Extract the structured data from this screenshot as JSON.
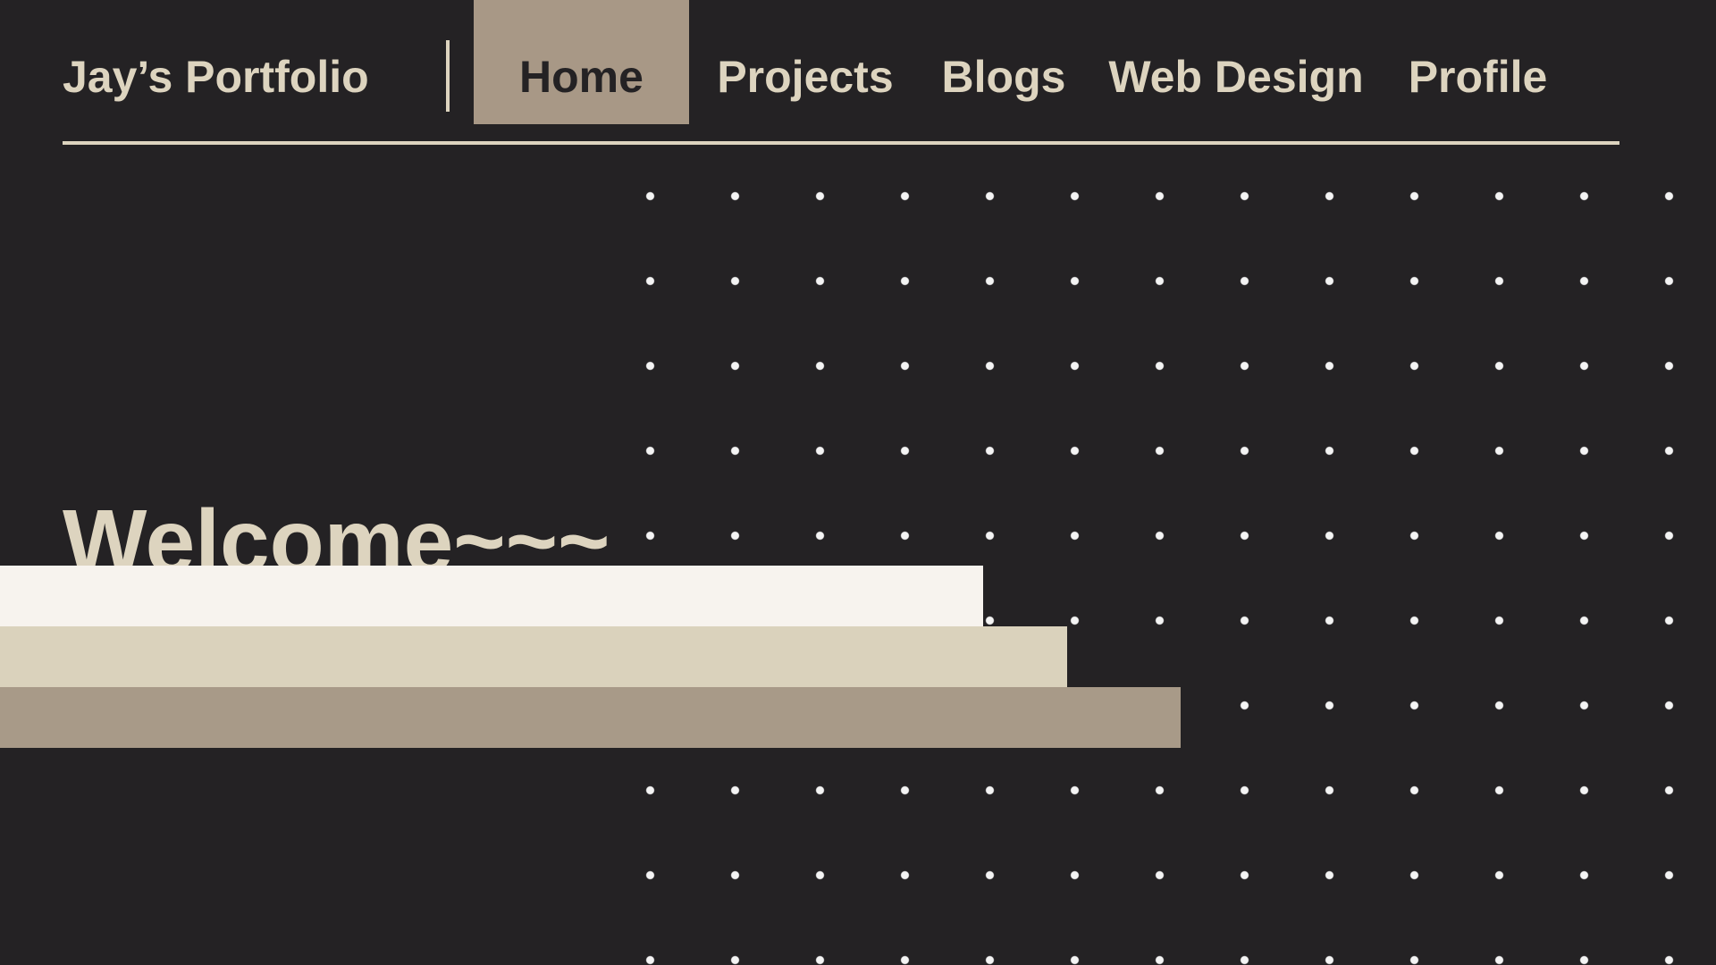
{
  "header": {
    "brand": "Jay’s Portfolio",
    "nav": {
      "home": "Home",
      "projects": "Projects",
      "blogs": "Blogs",
      "web_design": "Web Design",
      "profile": "Profile"
    },
    "active_tab": "Home"
  },
  "hero": {
    "title": "Welcome~~~"
  },
  "colors": {
    "background": "#242224",
    "text_beige": "#ddd4bf",
    "active_tab": "#a89886",
    "stripe_white": "#f7f3ee",
    "stripe_beige": "#dad2bc",
    "stripe_taupe": "#a89a88",
    "dots": "#ffffff"
  }
}
